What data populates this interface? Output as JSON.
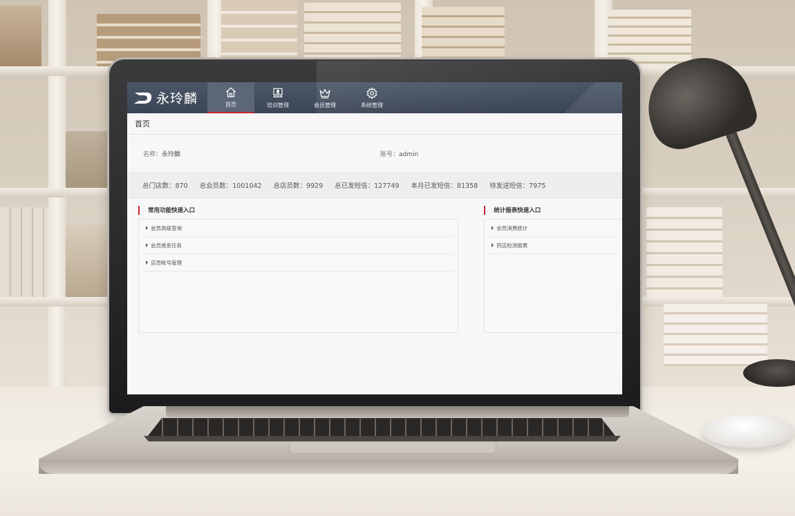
{
  "app": {
    "logo_text": "永玲麟"
  },
  "nav": [
    {
      "label": "首页",
      "icon": "home-icon",
      "active": true
    },
    {
      "label": "培训管理",
      "icon": "training-icon",
      "active": false
    },
    {
      "label": "会员管理",
      "icon": "crown-icon",
      "active": false
    },
    {
      "label": "系统管理",
      "icon": "gear-icon",
      "active": false
    }
  ],
  "breadcrumb": "首页",
  "profile": {
    "name_label": "名称：",
    "name_value": "永玲麟",
    "account_label": "账号：",
    "account_value": "admin"
  },
  "stats": [
    "总门店数：870",
    "总会员数：1001042",
    "总店员数：9929",
    "总已发短信：127749",
    "本月已发短信：81358",
    "待发送短信：7975"
  ],
  "panels": {
    "common": {
      "title": "常用功能快速入口",
      "links": [
        "会员高级查询",
        "会员维系任务",
        "店员帐号管理"
      ]
    },
    "reports": {
      "title": "统计报表快速入口",
      "links": [
        "会员消费统计",
        "药店检测报表"
      ]
    }
  },
  "colors": {
    "topbar": "#3f4a5a",
    "accent": "#c4242a",
    "page_bg": "#f7f7f7"
  }
}
